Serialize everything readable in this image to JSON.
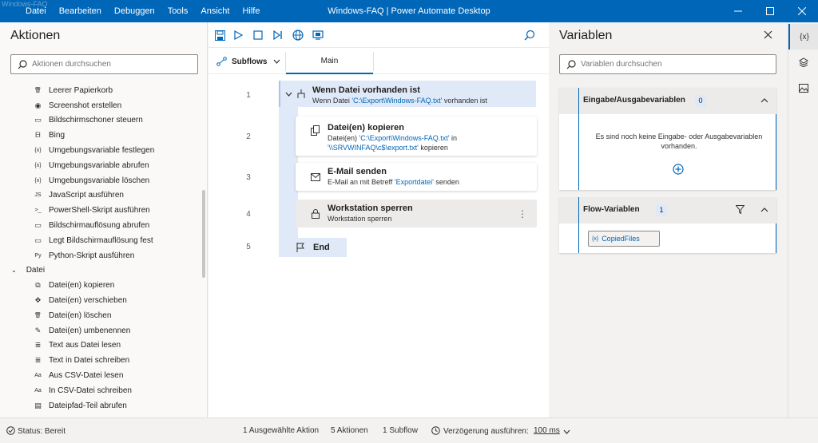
{
  "app": {
    "title": "Windows-FAQ | Power Automate Desktop",
    "ghost": "Windows-FAQ"
  },
  "menu": [
    "Datei",
    "Bearbeiten",
    "Debuggen",
    "Tools",
    "Ansicht",
    "Hilfe"
  ],
  "actions_panel": {
    "title": "Aktionen",
    "search_placeholder": "Aktionen durchsuchen",
    "items_top": [
      {
        "label": "Leerer Papierkorb",
        "icon": "recycle-bin-icon"
      },
      {
        "label": "Screenshot erstellen",
        "icon": "camera-icon"
      },
      {
        "label": "Bildschirmschoner steuern",
        "icon": "screensaver-icon"
      },
      {
        "label": "Bing",
        "icon": "bing-icon"
      },
      {
        "label": "Umgebungsvariable festlegen",
        "icon": "variable-icon"
      },
      {
        "label": "Umgebungsvariable abrufen",
        "icon": "variable-icon"
      },
      {
        "label": "Umgebungsvariable löschen",
        "icon": "variable-icon"
      },
      {
        "label": "JavaScript ausführen",
        "icon": "javascript-icon"
      },
      {
        "label": "PowerShell-Skript ausführen",
        "icon": "powershell-icon"
      },
      {
        "label": "Bildschirmauflösung abrufen",
        "icon": "monitor-icon"
      },
      {
        "label": "Legt Bildschirmauflösung fest",
        "icon": "monitor-icon"
      },
      {
        "label": "Python-Skript ausführen",
        "icon": "python-icon"
      }
    ],
    "group": "Datei",
    "items_group": [
      {
        "label": "Datei(en) kopieren",
        "icon": "copy-icon"
      },
      {
        "label": "Datei(en) verschieben",
        "icon": "move-icon"
      },
      {
        "label": "Datei(en) löschen",
        "icon": "delete-icon"
      },
      {
        "label": "Datei(en) umbenennen",
        "icon": "rename-icon"
      },
      {
        "label": "Text aus Datei lesen",
        "icon": "read-text-icon"
      },
      {
        "label": "Text in Datei schreiben",
        "icon": "write-text-icon"
      },
      {
        "label": "Aus CSV-Datei lesen",
        "icon": "csv-read-icon"
      },
      {
        "label": "In CSV-Datei schreiben",
        "icon": "csv-write-icon"
      },
      {
        "label": "Dateipfad-Teil abrufen",
        "icon": "file-path-icon"
      }
    ]
  },
  "editor": {
    "subflows_label": "Subflows",
    "tab_main": "Main",
    "line_numbers": [
      "1",
      "2",
      "3",
      "4",
      "5"
    ],
    "if_title": "Wenn Datei vorhanden ist",
    "if_sub_pre": "Wenn Datei ",
    "if_sub_link": "'C:\\Export\\Windows-FAQ.txt'",
    "if_sub_post": " vorhanden ist",
    "copy_title": "Datei(en) kopieren",
    "copy_sub_pre": "Datei(en) ",
    "copy_sub_link1": "'C:\\Export\\Windows-FAQ.txt'",
    "copy_sub_mid": " in ",
    "copy_sub_link2": "'\\\\SRVWINFAQ\\c$\\export.txt'",
    "copy_sub_post": " kopieren",
    "mail_title": "E-Mail senden",
    "mail_sub_pre": "E-Mail an  mit Betreff ",
    "mail_sub_link": "'Exportdatei'",
    "mail_sub_post": " senden",
    "lock_title": "Workstation sperren",
    "lock_sub": "Workstation sperren",
    "end_label": "End"
  },
  "variables_panel": {
    "title": "Variablen",
    "search_placeholder": "Variablen durchsuchen",
    "io_title": "Eingabe/Ausgabevariablen",
    "io_count": "0",
    "io_empty": "Es sind noch keine Eingabe- oder Ausgabevariablen vorhanden.",
    "flow_title": "Flow-Variablen",
    "flow_count": "1",
    "flow_var": "CopiedFiles"
  },
  "rail": {
    "var_label": "{x}"
  },
  "status": {
    "state": "Status: Bereit",
    "selected": "1 Ausgewählte Aktion",
    "actions": "5 Aktionen",
    "subflow": "1 Subflow",
    "delay_label": "Verzögerung ausführen:",
    "delay_value": "100 ms"
  }
}
